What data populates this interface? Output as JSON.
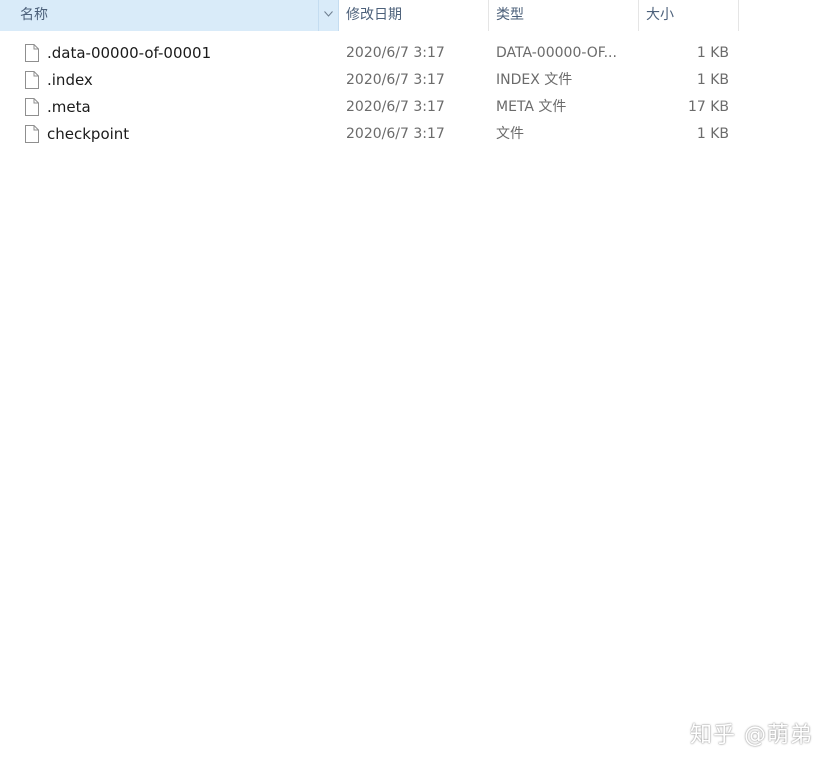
{
  "header": {
    "name_label": "名称",
    "date_label": "修改日期",
    "type_label": "类型",
    "size_label": "大小",
    "sort_indicator": "^",
    "filter_indicator": "v"
  },
  "files": [
    {
      "name": ".data-00000-of-00001",
      "modified": "2020/6/7 3:17",
      "type": "DATA-00000-OF...",
      "size": "1 KB"
    },
    {
      "name": ".index",
      "modified": "2020/6/7 3:17",
      "type": "INDEX 文件",
      "size": "1 KB"
    },
    {
      "name": ".meta",
      "modified": "2020/6/7 3:17",
      "type": "META 文件",
      "size": "17 KB"
    },
    {
      "name": "checkpoint",
      "modified": "2020/6/7 3:17",
      "type": "文件",
      "size": "1 KB"
    }
  ],
  "icons": {
    "file": "file-icon",
    "sort": "sort-up-icon",
    "filter": "chevron-down-icon"
  },
  "colors": {
    "selected_header_bg": "#d9ebf9",
    "header_text": "#4c607a",
    "secondary_text": "#6b6b6b"
  },
  "watermark": "知乎 @萌弟"
}
